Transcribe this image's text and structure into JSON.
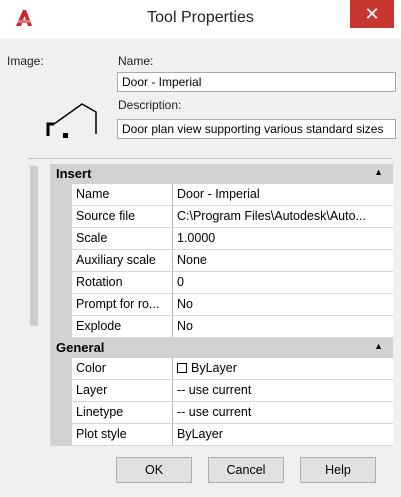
{
  "window": {
    "title": "Tool Properties",
    "close_glyph": "✕",
    "icon": "autocad-logo-icon"
  },
  "form": {
    "image_label": "Image:",
    "name_label": "Name:",
    "name_value": "Door - Imperial",
    "description_label": "Description:",
    "description_value": "Door plan view supporting various standard sizes",
    "image_icon": "door-plan-icon"
  },
  "categories": {
    "insert": {
      "label": "Insert",
      "rows": [
        {
          "name": "Name",
          "value": "Door - Imperial"
        },
        {
          "name": "Source file",
          "value": "C:\\Program Files\\Autodesk\\Auto..."
        },
        {
          "name": "Scale",
          "value": "1.0000"
        },
        {
          "name": "Auxiliary scale",
          "value": "None"
        },
        {
          "name": "Rotation",
          "value": "0"
        },
        {
          "name": "Prompt for ro...",
          "value": "No"
        },
        {
          "name": "Explode",
          "value": "No"
        }
      ]
    },
    "general": {
      "label": "General",
      "rows": [
        {
          "name": "Color",
          "value": "ByLayer"
        },
        {
          "name": "Layer",
          "value": "-- use current"
        },
        {
          "name": "Linetype",
          "value": "-- use current"
        },
        {
          "name": "Plot style",
          "value": "ByLayer"
        }
      ]
    },
    "collapse_glyph": "▲"
  },
  "buttons": {
    "ok": "OK",
    "cancel": "Cancel",
    "help": "Help"
  },
  "colors": {
    "close_button": "#c7372f",
    "category_header": "#d2d2d2",
    "dialog_background": "#f0f0f0"
  }
}
